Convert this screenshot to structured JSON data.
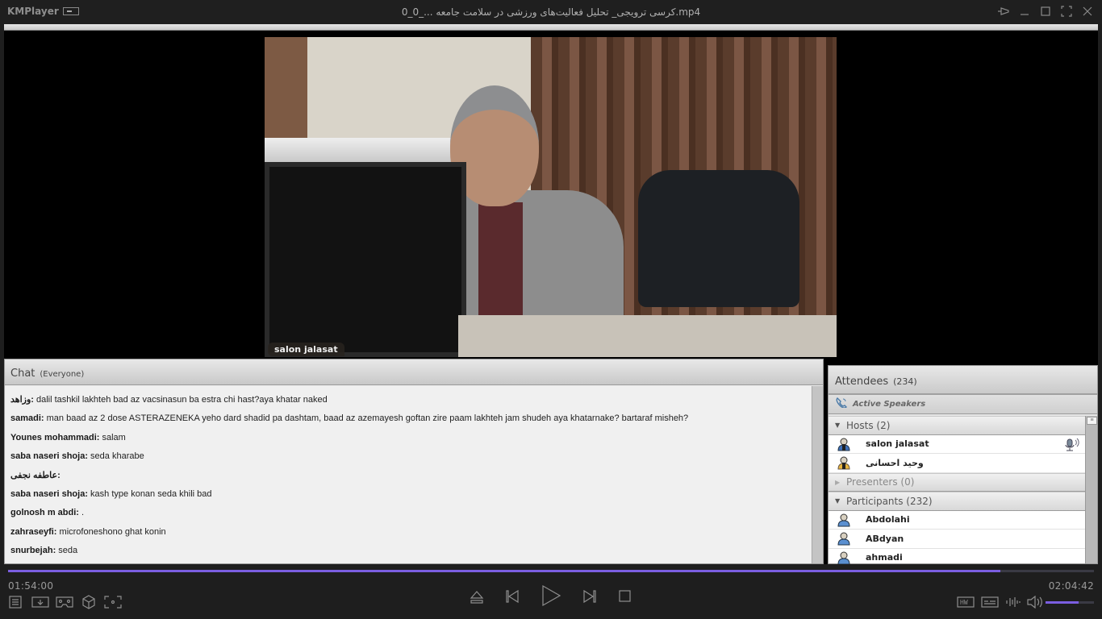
{
  "app": {
    "name": "KMPlayer",
    "window_title": "کرسی ترویجی_ تحلیل فعالیت‌های ورزشی در سلامت جامعه ..._0_0.mp4"
  },
  "video": {
    "camera_label": "salon jalasat"
  },
  "chat": {
    "title": "Chat",
    "scope": "(Everyone)",
    "messages": [
      {
        "sender": "وزاهد:",
        "text": " dalil tashkil lakhteh bad az vacsinasun ba estra chi hast?aya khatar naked"
      },
      {
        "sender": "samadi:",
        "text": " man baad az 2 dose ASTERAZENEKA yeho dard shadid pa dashtam, baad az azemayesh goftan zire paam lakhteh jam shudeh aya khatarnake? bartaraf misheh?"
      },
      {
        "sender": "Younes mohammadi:",
        "text": " salam"
      },
      {
        "sender": "saba naseri shoja:",
        "text": " seda kharabe"
      },
      {
        "sender": "عاطفه نجفی:",
        "text": ""
      },
      {
        "sender": "saba naseri shoja:",
        "text": " kash type konan seda khili bad"
      },
      {
        "sender": "golnosh m abdi:",
        "text": " ."
      },
      {
        "sender": "zahraseyfi:",
        "text": " microfoneshono ghat konin"
      },
      {
        "sender": "snurbejah:",
        "text": " seda"
      }
    ]
  },
  "attendees": {
    "title": "Attendees",
    "count": "(234)",
    "active_speakers": "Active Speakers",
    "groups": {
      "hosts": {
        "label": "Hosts (2)",
        "expanded": true
      },
      "presenters": {
        "label": "Presenters (0)",
        "expanded": false
      },
      "participants": {
        "label": "Participants (232)",
        "expanded": true
      }
    },
    "hosts": [
      {
        "name": "salon jalasat",
        "speaking": true
      },
      {
        "name": "وحید احسانی",
        "speaking": false
      }
    ],
    "participants": [
      {
        "name": "Abdolahi"
      },
      {
        "name": "ABdyan"
      },
      {
        "name": "ahmadi"
      }
    ]
  },
  "player": {
    "current_time": "01:54:00",
    "total_time": "02:04:42",
    "progress_percent": 91.4,
    "volume_percent": 68,
    "accent_color": "#7b5ee0",
    "hw_label": "HW"
  }
}
